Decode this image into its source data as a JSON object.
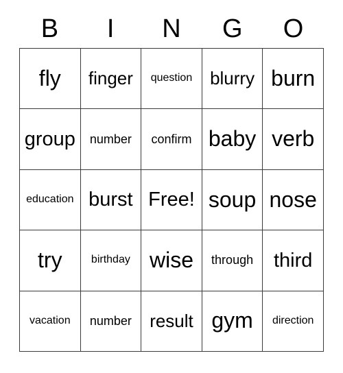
{
  "card": {
    "title": "BINGO",
    "header": [
      "B",
      "I",
      "N",
      "G",
      "O"
    ],
    "rows": [
      [
        {
          "text": "fly",
          "size": "len-xs"
        },
        {
          "text": "finger",
          "size": "len-md"
        },
        {
          "text": "question",
          "size": "len-xl"
        },
        {
          "text": "blurry",
          "size": "len-md"
        },
        {
          "text": "burn",
          "size": "len-xs"
        }
      ],
      [
        {
          "text": "group",
          "size": "len-sm"
        },
        {
          "text": "number",
          "size": "len-lg"
        },
        {
          "text": "confirm",
          "size": "len-lg"
        },
        {
          "text": "baby",
          "size": "len-xs"
        },
        {
          "text": "verb",
          "size": "len-xs"
        }
      ],
      [
        {
          "text": "education",
          "size": "len-xl"
        },
        {
          "text": "burst",
          "size": "len-sm"
        },
        {
          "text": "Free!",
          "size": "len-sm"
        },
        {
          "text": "soup",
          "size": "len-xs"
        },
        {
          "text": "nose",
          "size": "len-xs"
        }
      ],
      [
        {
          "text": "try",
          "size": "len-xs"
        },
        {
          "text": "birthday",
          "size": "len-xl"
        },
        {
          "text": "wise",
          "size": "len-xs"
        },
        {
          "text": "through",
          "size": "len-lg"
        },
        {
          "text": "third",
          "size": "len-sm"
        }
      ],
      [
        {
          "text": "vacation",
          "size": "len-xl"
        },
        {
          "text": "number",
          "size": "len-lg"
        },
        {
          "text": "result",
          "size": "len-md"
        },
        {
          "text": "gym",
          "size": "len-xs"
        },
        {
          "text": "direction",
          "size": "len-xl"
        }
      ]
    ],
    "free_space": {
      "row": 2,
      "column": 2,
      "label": "Free!"
    },
    "colors": {
      "background": "#ffffff",
      "text": "#000000",
      "grid_line": "#3a3a3a",
      "outer_border": "#262626"
    }
  }
}
